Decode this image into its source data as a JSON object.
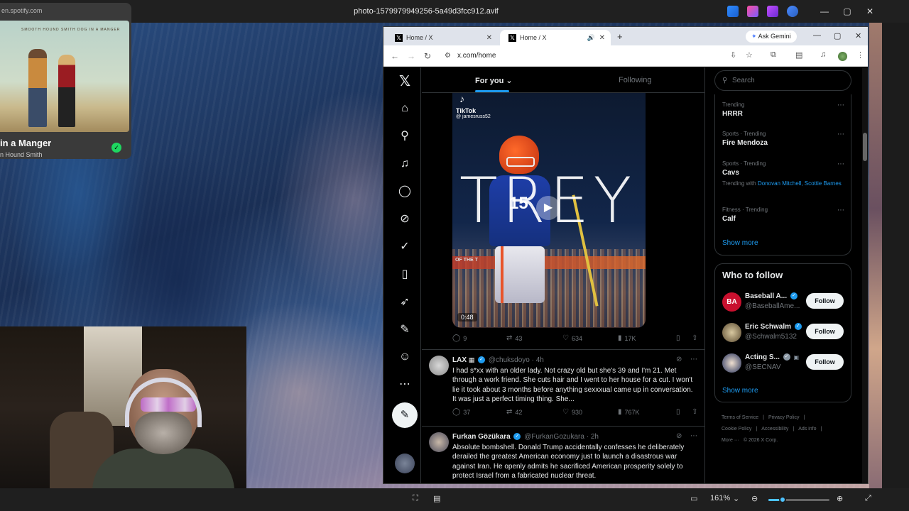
{
  "viewer": {
    "title": "photo-1579979949256-5a49d3fcc912.avif",
    "zoom": "161%",
    "zoom_level": 0.23
  },
  "spotify": {
    "url": "en.spotify.com",
    "album_text": "SMOOTH HOUND SMITH    DOG IN A MANGER",
    "track_title": "in a Manger",
    "artist": "n Hound Smith"
  },
  "browser": {
    "tabs": [
      {
        "label": "Home / X"
      },
      {
        "label": "Home / X"
      }
    ],
    "gemini": "Ask Gemini",
    "url": "x.com/home"
  },
  "feed": {
    "tabs": [
      {
        "label": "For you"
      },
      {
        "label": "Following"
      }
    ],
    "video": {
      "brand": "TikTok",
      "handle": "@ jamesruss52",
      "overlay_text": "TREY",
      "jersey_number": "15",
      "banner": "OF THE T",
      "duration": "0:48",
      "stats": {
        "replies": "9",
        "reposts": "43",
        "likes": "634",
        "views": "17K"
      }
    },
    "posts": [
      {
        "name": "LAX",
        "handle": "@chuksdoyo",
        "time": "4h",
        "text": "I had s*xx with an older lady. Not crazy old but she's 39 and I'm 21. Met through a work friend. She cuts hair and I went to her house for a cut. I won't lie it took about 3 months before anything sexxxual came up in conversation. It was just a perfect timing thing. She...",
        "stats": {
          "replies": "37",
          "reposts": "42",
          "likes": "930",
          "views": "767K"
        }
      },
      {
        "name": "Furkan Gözükara",
        "handle": "@FurkanGozukara",
        "time": "2h",
        "text": "Absolute bombshell. Donald Trump accidentally confesses he deliberately derailed the greatest American economy just to launch a disastrous war against Iran. He openly admits he sacrificed American prosperity solely to protect Israel from a fabricated nuclear threat."
      }
    ]
  },
  "sidebar": {
    "search_placeholder": "Search",
    "trends": [
      {
        "category": "Trending",
        "name": "HRRR"
      },
      {
        "category": "Sports · Trending",
        "name": "Fire Mendoza"
      },
      {
        "category": "Sports · Trending",
        "name": "Cavs",
        "with_prefix": "Trending with",
        "with_links": "Donovan Mitchell, Scottie Barnes"
      },
      {
        "category": "Fitness · Trending",
        "name": "Calf"
      }
    ],
    "show_more": "Show more",
    "who_to_follow": "Who to follow",
    "follow_suggestions": [
      {
        "name": "Baseball A...",
        "handle": "@BaseballAme...",
        "avatar_text": "BA",
        "button": "Follow"
      },
      {
        "name": "Eric Schwalm",
        "handle": "@Schwalm5132",
        "button": "Follow"
      },
      {
        "name": "Acting S...",
        "handle": "@SECNAV",
        "button": "Follow"
      }
    ],
    "show_more_2": "Show more",
    "footer": [
      "Terms of Service",
      "|",
      "Privacy Policy",
      "|",
      "Cookie Policy",
      "|",
      "Accessibility",
      "|",
      "Ads info",
      "|",
      "More ···",
      "© 2026 X Corp."
    ]
  },
  "colors": {
    "accent": "#1d9bf0",
    "background": "#000000",
    "text": "#e7e9ea",
    "muted": "#71767b",
    "spotify_green": "#1ed760"
  }
}
